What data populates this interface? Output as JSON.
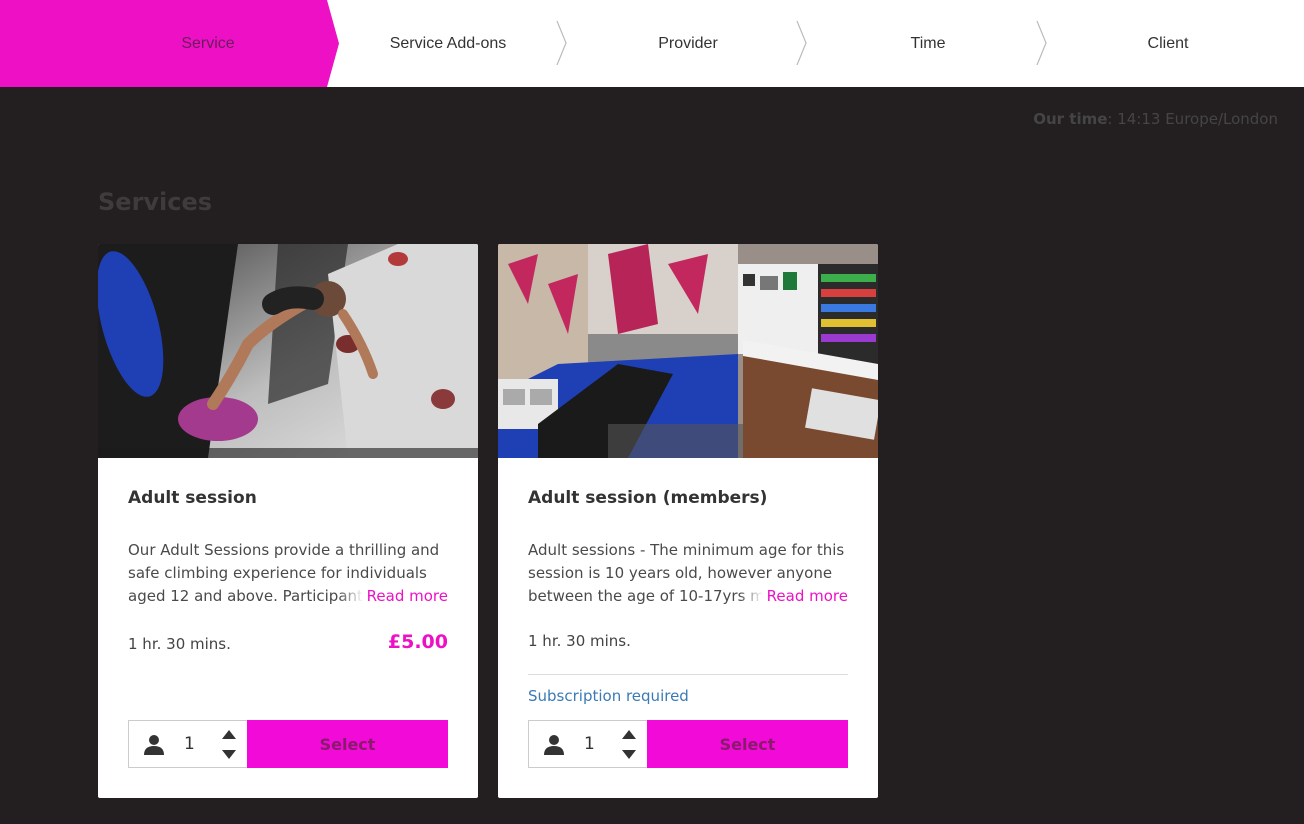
{
  "steps": [
    {
      "label": "Service",
      "active": true
    },
    {
      "label": "Service Add-ons",
      "active": false
    },
    {
      "label": "Provider",
      "active": false
    },
    {
      "label": "Time",
      "active": false
    },
    {
      "label": "Client",
      "active": false
    }
  ],
  "our_time": {
    "label": "Our time",
    "value": ": 14:13 Europe/London"
  },
  "section_title": "Services",
  "services": [
    {
      "title": "Adult session",
      "description": "Our Adult Sessions provide a thrilling and safe climbing experience for individuals aged 12 and above. Participants",
      "read_more": "Read more",
      "duration": "1 hr. 30 mins.",
      "price": "£5.00",
      "quantity": "1",
      "select_label": "Select",
      "image_icon": "climber-photo"
    },
    {
      "title": "Adult session (members)",
      "description": "Adult sessions - The minimum age for this session is 10 years old, however anyone between the age of 10-17yrs must",
      "read_more": "Read more",
      "duration": "1 hr. 30 mins.",
      "subscription": "Subscription required",
      "quantity": "1",
      "select_label": "Select",
      "image_icon": "reception-photo"
    }
  ],
  "colors": {
    "accent": "#ed10c5",
    "button": "#f20ad8",
    "background": "#231f20",
    "link": "#3a7ab5"
  }
}
